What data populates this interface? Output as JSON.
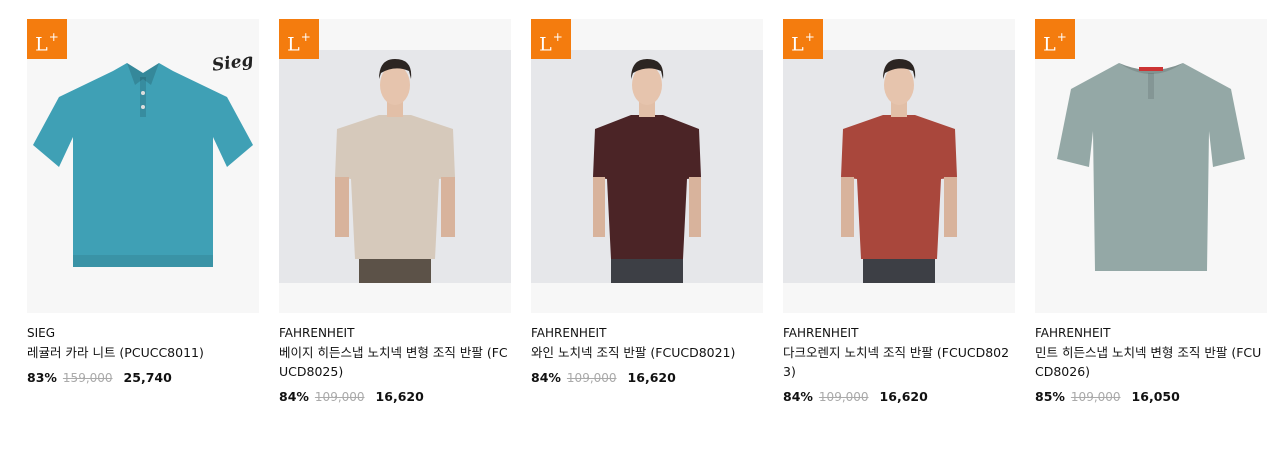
{
  "badge": "L",
  "products": [
    {
      "brand": "SIEG",
      "name": "레귤러 카라 니트 (PCUCC8011)",
      "discount": "83%",
      "original": "159,000",
      "price": "25,740",
      "watermark": "Sieg",
      "color": "#3fa0b5"
    },
    {
      "brand": "FAHRENHEIT",
      "name": "베이지 히든스냅 노치넥 변형 조직 반팔 (FCUCD8025)",
      "discount": "84%",
      "original": "109,000",
      "price": "16,620",
      "color": "#d6c9bb"
    },
    {
      "brand": "FAHRENHEIT",
      "name": "와인 노치넥 조직 반팔 (FCUCD8021)",
      "discount": "84%",
      "original": "109,000",
      "price": "16,620",
      "color": "#4b2426"
    },
    {
      "brand": "FAHRENHEIT",
      "name": "다크오렌지 노치넥 조직 반팔 (FCUCD8023)",
      "discount": "84%",
      "original": "109,000",
      "price": "16,620",
      "color": "#a9473c"
    },
    {
      "brand": "FAHRENHEIT",
      "name": "민트 히든스냅 노치넥 변형 조직 반팔 (FCUCD8026)",
      "discount": "85%",
      "original": "109,000",
      "price": "16,050",
      "color": "#94a8a6"
    }
  ]
}
